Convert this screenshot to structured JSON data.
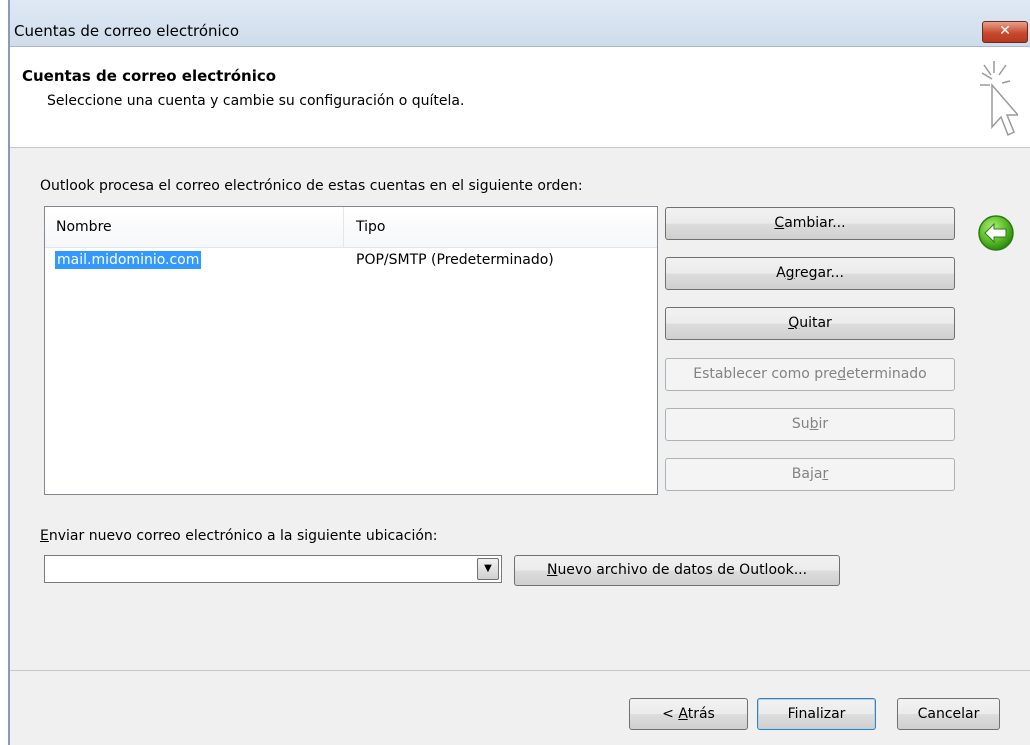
{
  "window": {
    "title": "Cuentas de correo electrónico",
    "close_label": "✕"
  },
  "header": {
    "title": "Cuentas de correo electrónico",
    "subtitle": "Seleccione una cuenta y cambie su configuración o quítela."
  },
  "accounts": {
    "description": "Outlook procesa el correo electrónico de estas cuentas en el siguiente orden:",
    "columns": [
      "Nombre",
      "Tipo"
    ],
    "rows": [
      {
        "name": "mail.midominio.com",
        "type": "POP/SMTP (Predeterminado)"
      }
    ]
  },
  "actions": {
    "change": {
      "pre": "",
      "key": "C",
      "post": "ambiar..."
    },
    "add": {
      "pre": "A",
      "key": "g",
      "post": "regar..."
    },
    "remove": {
      "pre": "",
      "key": "Q",
      "post": "uitar"
    },
    "set_default": {
      "pre": "Establecer como pre",
      "key": "d",
      "post": "eterminado"
    },
    "move_up": {
      "pre": "Su",
      "key": "b",
      "post": "ir"
    },
    "move_down": {
      "pre": "Baja",
      "key": "r",
      "post": ""
    }
  },
  "delivery": {
    "label_key": "E",
    "label_rest": "nviar nuevo correo electrónico a la siguiente ubicación:",
    "selected_value": "",
    "new_file_key": "N",
    "new_file_rest": "uevo archivo de datos de Outlook..."
  },
  "footer": {
    "back_pre": "< ",
    "back_key": "A",
    "back_post": "trás",
    "finish_label": "Finalizar",
    "cancel_label": "Cancelar"
  },
  "icons": {
    "close": "close-icon",
    "wizard": "wizard-cursor-icon",
    "back": "green-back-arrow-icon",
    "combo_arrow": "dropdown-arrow-icon"
  },
  "colors": {
    "selection": "#3399ff",
    "back_icon": "#5cbf2a",
    "close_button": "#c74a2f"
  }
}
